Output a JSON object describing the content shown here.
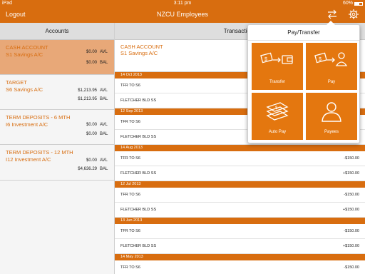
{
  "status_bar": {
    "device": "iPad",
    "time": "3:11 pm",
    "battery": "60%"
  },
  "nav": {
    "logout": "Logout",
    "title": "NZCU Employees"
  },
  "accounts": {
    "header": "Accounts",
    "items": [
      {
        "name": "CASH ACCOUNT",
        "sub": "S1 Savings A/C",
        "avl": "$0.00",
        "bal": "$0.00",
        "avl_tag": "AVL",
        "bal_tag": "BAL"
      },
      {
        "name": "TARGET",
        "sub": "S6 Savings A/C",
        "avl": "$1,213.95",
        "bal": "$1,213.95",
        "avl_tag": "AVL",
        "bal_tag": "BAL"
      },
      {
        "name": "TERM DEPOSITS - 6 MTH",
        "sub": "I6 Investment A/C",
        "avl": "$0.00",
        "bal": "$0.00",
        "avl_tag": "AVL",
        "bal_tag": "BAL"
      },
      {
        "name": "TERM DEPOSITS - 12 MTH",
        "sub": "I12 Investment A/C",
        "avl": "$0.00",
        "bal": "$4,636.29",
        "avl_tag": "AVL",
        "bal_tag": "BAL"
      }
    ]
  },
  "transactions": {
    "header": "Transactions",
    "account_name": "CASH ACCOUNT",
    "account_sub": "S1 Savings A/C",
    "groups": [
      {
        "date": "14 Oct 2013",
        "rows": [
          {
            "desc": "TFR TO S6",
            "amount": ""
          },
          {
            "desc": "FLETCHER BLD SS",
            "amount": ""
          }
        ]
      },
      {
        "date": "12 Sep 2013",
        "rows": [
          {
            "desc": "TFR TO S6",
            "amount": ""
          },
          {
            "desc": "FLETCHER BLD SS",
            "amount": ""
          }
        ]
      },
      {
        "date": "14 Aug 2013",
        "rows": [
          {
            "desc": "TFR TO S6",
            "amount": "-$150.00"
          },
          {
            "desc": "FLETCHER BLD SS",
            "amount": "+$150.00"
          }
        ]
      },
      {
        "date": "12 Jul 2013",
        "rows": [
          {
            "desc": "TFR TO S6",
            "amount": "-$150.00"
          },
          {
            "desc": "FLETCHER BLD SS",
            "amount": "+$150.00"
          }
        ]
      },
      {
        "date": "13 Jun 2013",
        "rows": [
          {
            "desc": "TFR TO S6",
            "amount": "-$150.00"
          },
          {
            "desc": "FLETCHER BLD SS",
            "amount": "+$150.00"
          }
        ]
      },
      {
        "date": "14 May 2013",
        "rows": [
          {
            "desc": "TFR TO S6",
            "amount": "-$150.00"
          }
        ]
      }
    ]
  },
  "popup": {
    "title": "Pay/Transfer",
    "tiles": [
      {
        "label": "Transfer",
        "icon": "transfer-icon"
      },
      {
        "label": "Pay",
        "icon": "pay-icon"
      },
      {
        "label": "Auto Pay",
        "icon": "auto-pay-icon"
      },
      {
        "label": "Payees",
        "icon": "payees-icon"
      }
    ]
  },
  "colors": {
    "accent": "#d86d0f",
    "tile": "#e4770f",
    "selected": "#e8a878"
  }
}
